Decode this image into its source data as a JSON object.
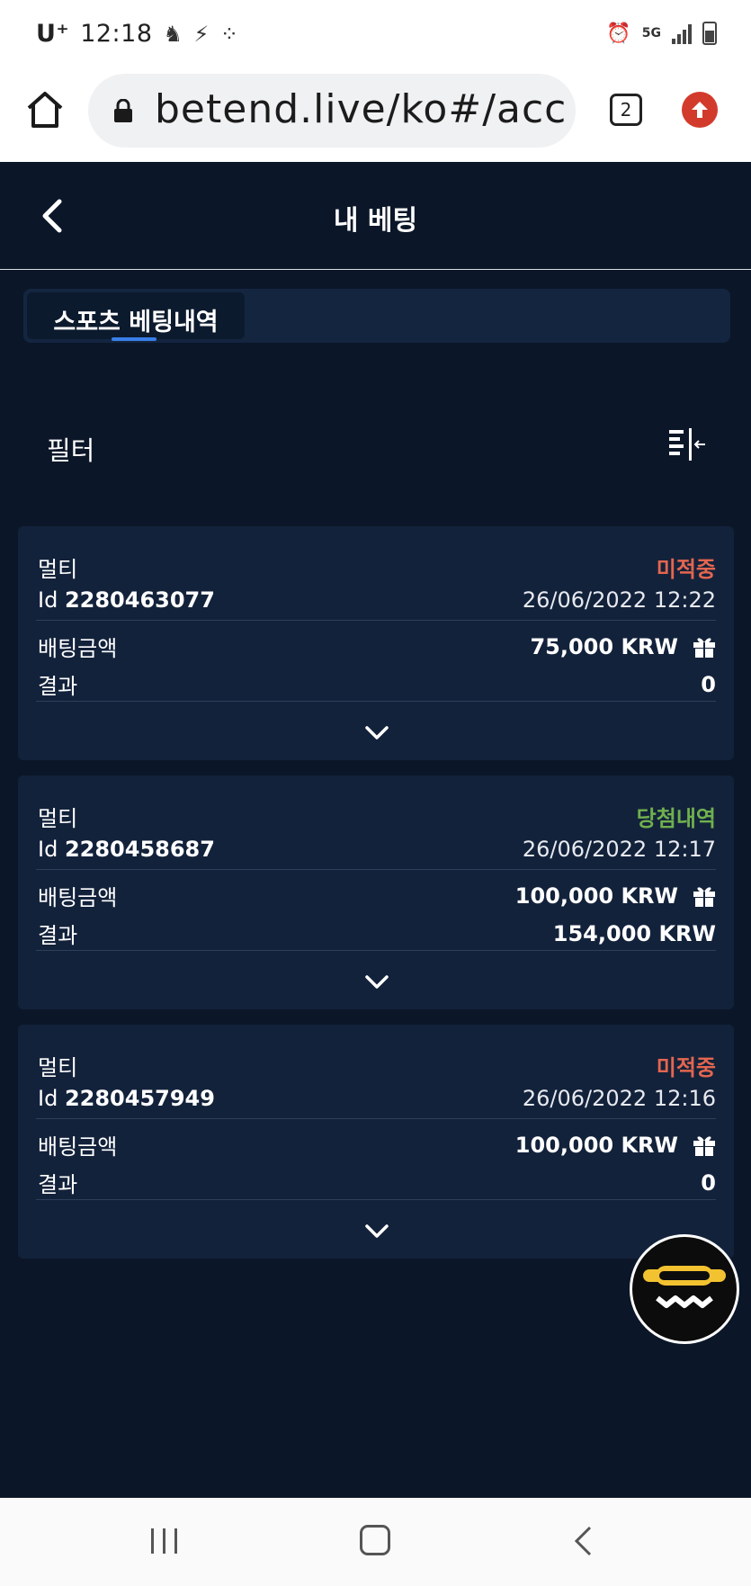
{
  "status_bar": {
    "carrier": "U⁺",
    "time": "12:18",
    "network": "5G"
  },
  "browser": {
    "url": "betend.live/ko#/acc",
    "tab_count": "2"
  },
  "header": {
    "title": "내 베팅"
  },
  "tabs": [
    {
      "label": "스포츠 베팅내역",
      "active": true
    }
  ],
  "filter": {
    "label": "필터"
  },
  "bets": [
    {
      "type": "멀티",
      "status": "미적중",
      "status_kind": "pending",
      "id_label": "Id",
      "id": "2280463077",
      "datetime": "26/06/2022 12:22",
      "amount_label": "배팅금액",
      "amount": "75,000 KRW",
      "result_label": "결과",
      "result": "0"
    },
    {
      "type": "멀티",
      "status": "당첨내역",
      "status_kind": "won",
      "id_label": "Id",
      "id": "2280458687",
      "datetime": "26/06/2022 12:17",
      "amount_label": "배팅금액",
      "amount": "100,000 KRW",
      "result_label": "결과",
      "result": "154,000 KRW"
    },
    {
      "type": "멀티",
      "status": "미적중",
      "status_kind": "pending",
      "id_label": "Id",
      "id": "2280457949",
      "datetime": "26/06/2022 12:16",
      "amount_label": "배팅금액",
      "amount": "100,000 KRW",
      "result_label": "결과",
      "result": "0"
    }
  ],
  "colors": {
    "background": "#0b1728",
    "card": "#13223b",
    "pending": "#e4664f",
    "won": "#6fb04e",
    "accent": "#3a7fe8",
    "fab_yellow": "#f2c230"
  },
  "icons": {
    "back": "chevron-left-icon",
    "filter": "filter-collapse-icon",
    "gift": "gift-icon",
    "expand": "chevron-down-icon",
    "fab": "chat-support-icon"
  }
}
